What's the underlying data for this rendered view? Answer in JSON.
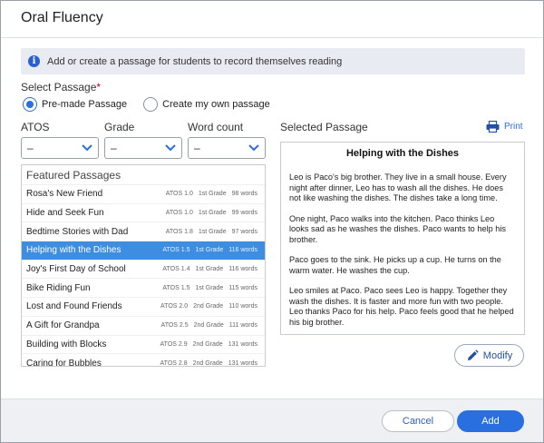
{
  "dialog": {
    "title": "Oral Fluency",
    "info_text": "Add or create a passage for students to record themselves reading"
  },
  "select_passage": {
    "label": "Select Passage",
    "required_mark": "*",
    "options": [
      {
        "label": "Pre-made Passage",
        "checked": true
      },
      {
        "label": "Create my own passage",
        "checked": false
      }
    ]
  },
  "filters": [
    {
      "label": "ATOS",
      "value": "–"
    },
    {
      "label": "Grade",
      "value": "–"
    },
    {
      "label": "Word count",
      "value": "–"
    }
  ],
  "featured": {
    "heading": "Featured Passages",
    "passages": [
      {
        "name": "Rosa's New Friend",
        "atos": "ATOS 1.0",
        "grade": "1st Grade",
        "words": "98 words",
        "selected": false
      },
      {
        "name": "Hide and Seek Fun",
        "atos": "ATOS 1.0",
        "grade": "1st Grade",
        "words": "99 words",
        "selected": false
      },
      {
        "name": "Bedtime Stories with Dad",
        "atos": "ATOS 1.8",
        "grade": "1st Grade",
        "words": "97 words",
        "selected": false
      },
      {
        "name": "Helping with the Dishes",
        "atos": "ATOS 1.5",
        "grade": "1st Grade",
        "words": "116 words",
        "selected": true
      },
      {
        "name": "Joy's First Day of School",
        "atos": "ATOS 1.4",
        "grade": "1st Grade",
        "words": "116 words",
        "selected": false
      },
      {
        "name": "Bike Riding Fun",
        "atos": "ATOS 1.5",
        "grade": "1st Grade",
        "words": "115 words",
        "selected": false
      },
      {
        "name": "Lost and Found Friends",
        "atos": "ATOS 2.0",
        "grade": "2nd Grade",
        "words": "110 words",
        "selected": false
      },
      {
        "name": "A Gift for Grandpa",
        "atos": "ATOS 2.5",
        "grade": "2nd Grade",
        "words": "111 words",
        "selected": false
      },
      {
        "name": "Building with Blocks",
        "atos": "ATOS 2.9",
        "grade": "2nd Grade",
        "words": "131 words",
        "selected": false
      },
      {
        "name": "Caring for Bubbles",
        "atos": "ATOS 2.8",
        "grade": "2nd Grade",
        "words": "131 words",
        "selected": false
      }
    ]
  },
  "selected_passage": {
    "label": "Selected Passage",
    "print_label": "Print",
    "title": "Helping with the Dishes",
    "paragraphs": [
      "Leo is Paco's big brother. They live in a small house. Every night after dinner, Leo has to wash all the dishes. He does not like washing the dishes. The dishes take a long time.",
      "One night, Paco walks into the kitchen. Paco thinks Leo looks sad as he washes the dishes. Paco wants to help his brother.",
      "Paco goes to the sink. He picks up a cup. He turns on the warm water. He washes the cup.",
      "Leo smiles at Paco. Paco sees Leo is happy. Together they wash the dishes. It is faster and more fun with two people. Leo thanks Paco for his help. Paco feels good that he helped his big brother."
    ],
    "modify_label": "Modify"
  },
  "footer": {
    "cancel_label": "Cancel",
    "add_label": "Add"
  },
  "colors": {
    "accent": "#2a6fe0",
    "selected_row": "#3d8ee0",
    "required": "#d0021b"
  },
  "icons": [
    "info-icon",
    "chevron-down-icon",
    "printer-icon",
    "pencil-icon"
  ]
}
